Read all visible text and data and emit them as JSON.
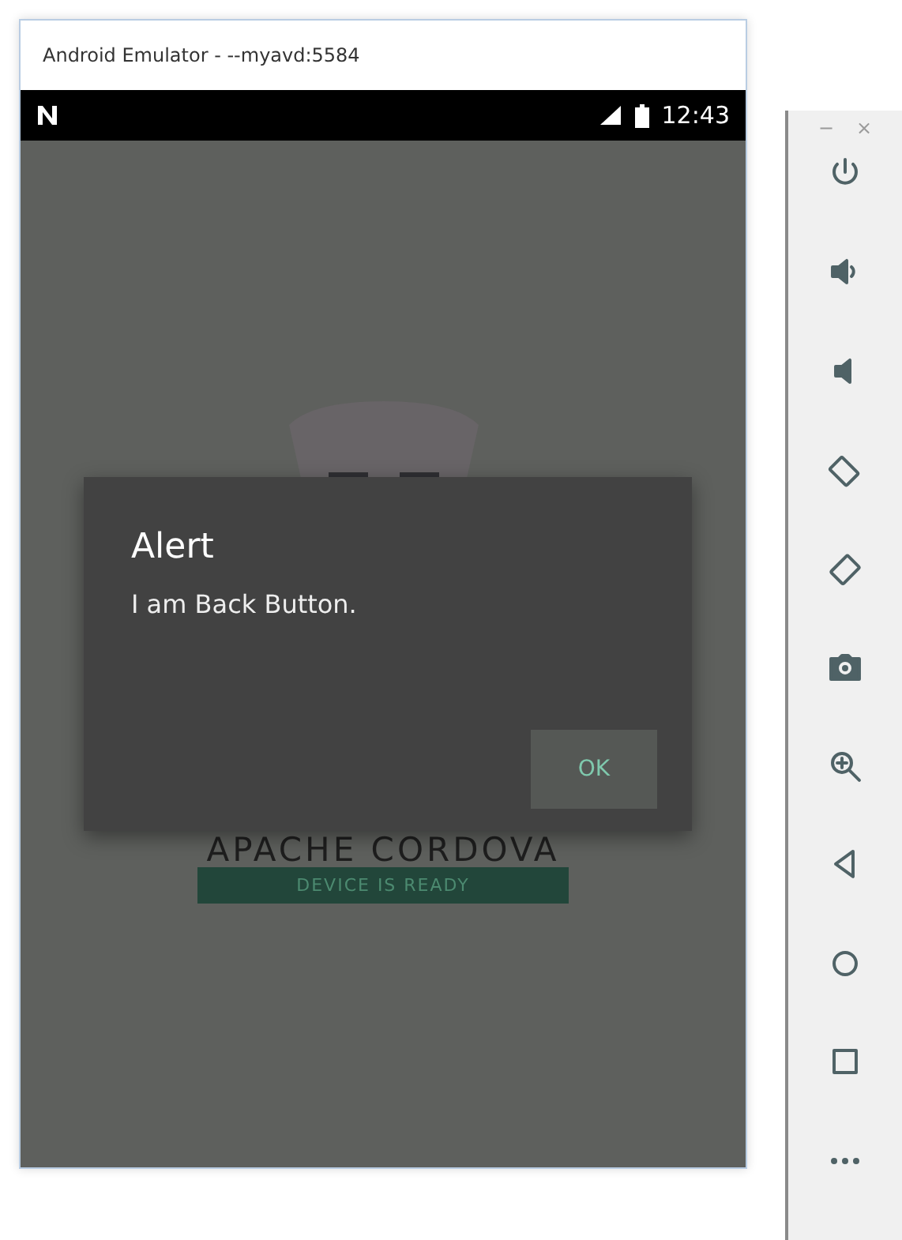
{
  "window": {
    "title": "Android Emulator - --myavd:5584"
  },
  "status_bar": {
    "time": "12:43"
  },
  "app": {
    "heading": "APACHE CORDOVA",
    "status": "DEVICE IS READY"
  },
  "dialog": {
    "title": "Alert",
    "message": "I am Back Button.",
    "buttons": [
      "OK"
    ]
  },
  "toolbar": {
    "window_controls": [
      "−",
      "×"
    ]
  }
}
